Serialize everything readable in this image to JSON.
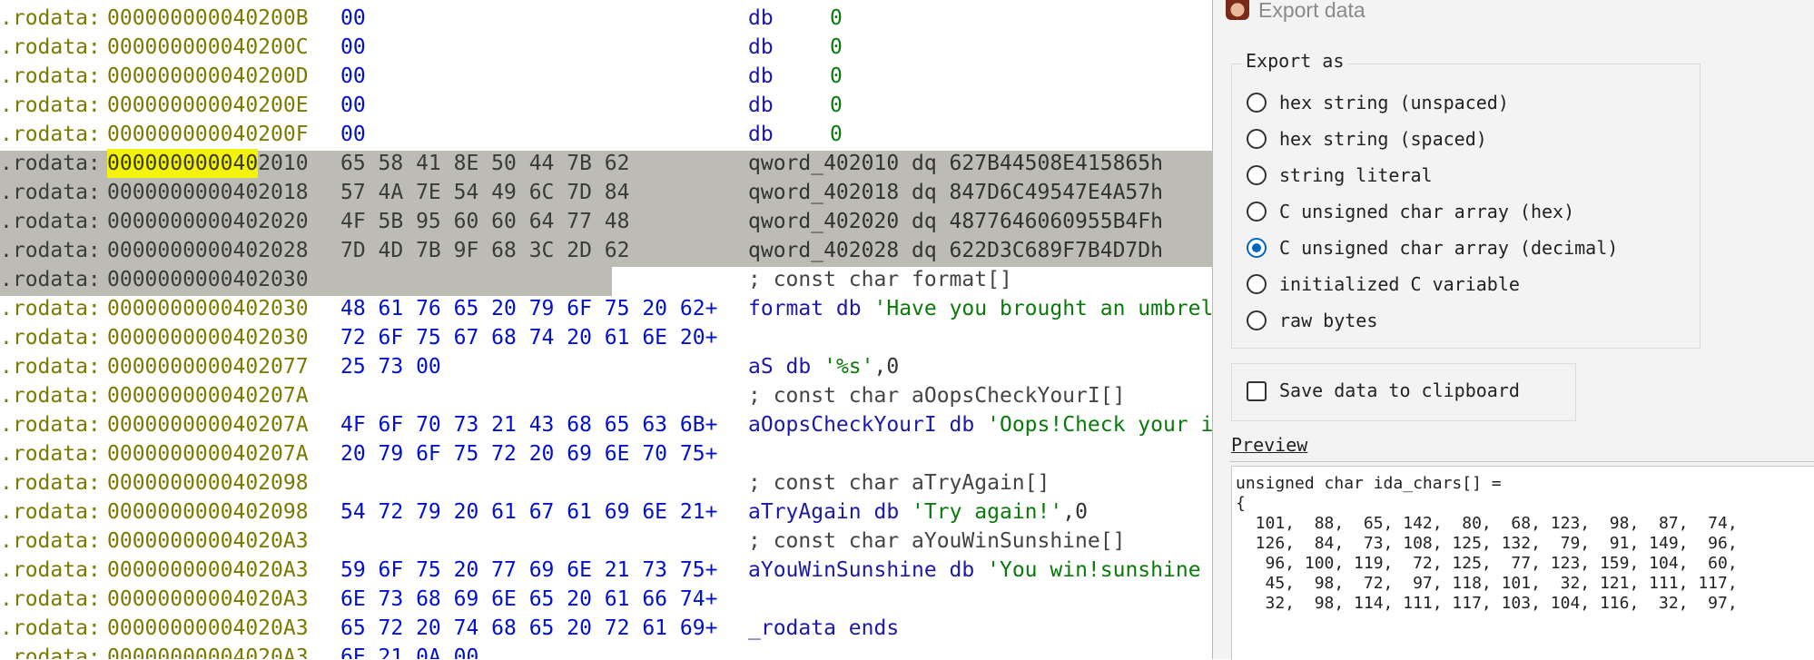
{
  "disasm": {
    "rows": [
      {
        "seg": ".rodata:",
        "addr": "000000000040200B",
        "hex": "00",
        "instr": "db",
        "operand": "0"
      },
      {
        "seg": ".rodata:",
        "addr": "000000000040200C",
        "hex": "00",
        "instr": "db",
        "operand": "0"
      },
      {
        "seg": ".rodata:",
        "addr": "000000000040200D",
        "hex": "00",
        "instr": "db",
        "operand": "0"
      },
      {
        "seg": ".rodata:",
        "addr": "000000000040200E",
        "hex": "00",
        "instr": "db",
        "operand": "0"
      },
      {
        "seg": ".rodata:",
        "addr": "000000000040200F",
        "hex": "00",
        "instr": "db",
        "operand": "0"
      }
    ],
    "selected_rows": [
      {
        "seg": ".rodata:",
        "addr_hl": "000000000040",
        "addr_rest": "2010",
        "hex": "65 58 41 8E 50 44 7B 62",
        "text": "qword_402010 dq 627B44508E415865h"
      },
      {
        "seg": ".rodata:",
        "addr_hl": "",
        "addr_rest": "0000000000402018",
        "hex": "57 4A 7E 54 49 6C 7D 84",
        "text": "qword_402018 dq 847D6C49547E4A57h"
      },
      {
        "seg": ".rodata:",
        "addr_hl": "",
        "addr_rest": "0000000000402020",
        "hex": "4F 5B 95 60 60 64 77 48",
        "text": "qword_402020 dq 4877646060955B4Fh"
      },
      {
        "seg": ".rodata:",
        "addr_hl": "",
        "addr_rest": "0000000000402028",
        "hex": "7D 4D 7B 9F 68 3C 2D 62",
        "text": "qword_402028 dq 622D3C689F7B4D7Dh"
      },
      {
        "seg": ".rodata:",
        "addr_hl": "",
        "addr_rest": "0000000000402030",
        "hex": "",
        "text": ""
      }
    ],
    "format_comment": "; const char format[]",
    "tail_rows": [
      {
        "seg": ".rodata:",
        "addr": "0000000000402030",
        "hex": "48 61 76 65 20 79 6F 75 20 62+",
        "name": "format db ",
        "str": "'Have you brought an umbrella",
        "kind": "str"
      },
      {
        "seg": ".rodata:",
        "addr": "0000000000402030",
        "hex": "72 6F 75 67 68 74 20 61 6E 20+",
        "name": "",
        "str": "",
        "kind": "plain"
      },
      {
        "seg": ".rodata:",
        "addr": "0000000000402077",
        "hex": "25 73 00",
        "name": "aS db ",
        "str": "'%s'",
        "tail": ",0",
        "kind": "str"
      },
      {
        "seg": ".rodata:",
        "addr": "000000000040207A",
        "hex": "",
        "comment": "; const char aOopsCheckYourI[]",
        "kind": "comment"
      },
      {
        "seg": ".rodata:",
        "addr": "000000000040207A",
        "hex": "4F 6F 70 73 21 43 68 65 63 6B+",
        "name": "aOopsCheckYourI db ",
        "str": "'Oops!Check your input",
        "kind": "str"
      },
      {
        "seg": ".rodata:",
        "addr": "000000000040207A",
        "hex": "20 79 6F 75 72 20 69 6E 70 75+",
        "name": "",
        "str": "",
        "kind": "plain"
      },
      {
        "seg": ".rodata:",
        "addr": "0000000000402098",
        "hex": "",
        "comment": "; const char aTryAgain[]",
        "kind": "comment"
      },
      {
        "seg": ".rodata:",
        "addr": "0000000000402098",
        "hex": "54 72 79 20 61 67 61 69 6E 21+",
        "name": "aTryAgain db ",
        "str": "'Try again!'",
        "tail": ",0",
        "kind": "str"
      },
      {
        "seg": ".rodata:",
        "addr": "00000000004020A3",
        "hex": "",
        "comment": "; const char aYouWinSunshine[]",
        "kind": "comment"
      },
      {
        "seg": ".rodata:",
        "addr": "00000000004020A3",
        "hex": "59 6F 75 20 77 69 6E 21 73 75+",
        "name": "aYouWinSunshine db ",
        "str": "'You win!sunshine",
        "kind": "str"
      },
      {
        "seg": ".rodata:",
        "addr": "00000000004020A3",
        "hex": "6E 73 68 69 6E 65 20 61 66 74+",
        "name": "",
        "str": "",
        "kind": "plain"
      },
      {
        "seg": ".rodata:",
        "addr": "00000000004020A3",
        "hex": "65 72 20 74 68 65 20 72 61 69+",
        "name": "_rodata ends",
        "str": "",
        "kind": "ends"
      },
      {
        "seg": ".rodata:",
        "addr": "00000000004020A3",
        "hex": "6E 21 0A 00",
        "name": "",
        "str": "",
        "kind": "plain"
      }
    ]
  },
  "dialog": {
    "title": "Export data",
    "export_as_label": "Export as",
    "options": [
      {
        "label": "hex string (unspaced)",
        "selected": false
      },
      {
        "label": "hex string (spaced)",
        "selected": false
      },
      {
        "label": "string literal",
        "selected": false
      },
      {
        "label": "C unsigned char array (hex)",
        "selected": false
      },
      {
        "label": "C unsigned char array (decimal)",
        "selected": true
      },
      {
        "label": "initialized C variable",
        "selected": false
      },
      {
        "label": "raw bytes",
        "selected": false
      }
    ],
    "clipboard_label": "Save data to clipboard",
    "clipboard_checked": false,
    "preview_label_first": "P",
    "preview_label_rest": "review",
    "preview_lines": [
      "unsigned char ida_chars[] =",
      "{",
      "  101,  88,  65, 142,  80,  68, 123,  98,  87,  74,",
      "  126,  84,  73, 108, 125, 132,  79,  91, 149,  96,",
      "   96, 100, 119,  72, 125,  77, 123, 159, 104,  60,",
      "   45,  98,  72,  97, 118, 101,  32, 121, 111, 117,",
      "   32,  98, 114, 111, 117, 103, 104, 116,  32,  97,"
    ]
  }
}
